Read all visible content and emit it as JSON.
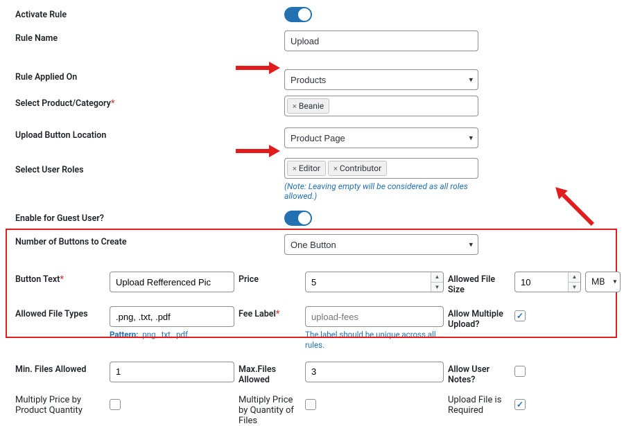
{
  "labels": {
    "activate_rule": "Activate Rule",
    "rule_name": "Rule Name",
    "rule_applied_on": "Rule Applied On",
    "select_product_category": "Select Product/Category",
    "upload_button_location": "Upload Button Location",
    "select_user_roles": "Select User Roles",
    "enable_guest": "Enable for Guest User?",
    "num_buttons": "Number of Buttons to Create",
    "button_text": "Button Text",
    "price": "Price",
    "allowed_file_size": "Allowed File Size",
    "allowed_file_types": "Allowed File Types",
    "fee_label": "Fee Label",
    "allow_multi": "Allow Multiple Upload?",
    "min_files": "Min. Files Allowed",
    "max_files": "Max.Files Allowed",
    "allow_notes": "Allow User Notes?",
    "mult_price_qty": "Multiply Price by Product Quantity",
    "mult_price_files": "Multiply Price by Quantity of Files",
    "upload_required": "Upload File is Required"
  },
  "values": {
    "rule_name": "Upload",
    "rule_applied_on": "Products",
    "upload_button_location": "Product Page",
    "num_buttons": "One Button",
    "button_text": "Upload Refferenced Pic",
    "price": "5",
    "allowed_file_size": "10",
    "allowed_file_size_unit": "MB",
    "allowed_file_types": ".png, .txt, .pdf",
    "min_files": "1",
    "max_files": "3"
  },
  "tags": {
    "products": [
      "Beanie"
    ],
    "roles": [
      "Editor",
      "Contributor"
    ]
  },
  "hints": {
    "roles_note": "(Note: Leaving empty will be considered as all roles allowed.)",
    "file_types_pattern": "Pattern: .png, .txt, .pdf",
    "fee_label_note": "The label should be unique across all rules.",
    "fee_label_placeholder": "upload-fees"
  },
  "toggles": {
    "activate_rule": true,
    "enable_guest": true
  },
  "checks": {
    "allow_multi": true,
    "allow_notes": false,
    "mult_price_qty": false,
    "mult_price_files": false,
    "upload_required": true
  }
}
